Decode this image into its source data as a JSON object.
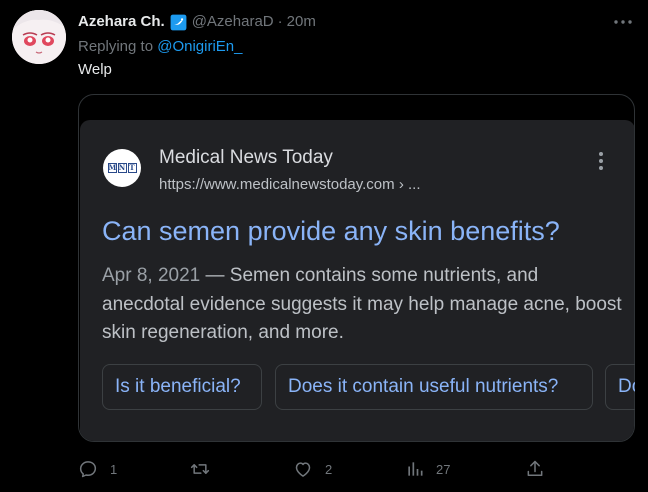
{
  "tweet": {
    "display_name": "Azehara Ch.",
    "handle": "@AzeharaD",
    "separator": "·",
    "time": "20m",
    "reply_prefix": "Replying to",
    "reply_to": "@OnigiriEn_",
    "text": "Welp"
  },
  "search_result": {
    "site_name": "Medical News Today",
    "site_url": "https://www.medicalnewstoday.com › ...",
    "logo_letters": [
      "M",
      "N",
      "T"
    ],
    "title": "Can semen provide any skin benefits?",
    "date": "Apr 8, 2021",
    "snippet": " — Semen contains some nutrients, and anecdotal evidence suggests it may help manage acne, boost skin regeneration, and more.",
    "chips": [
      "Is it beneficial?",
      "Does it contain useful nutrients?",
      "Do"
    ]
  },
  "actions": {
    "reply_count": "1",
    "retweet_count": "",
    "like_count": "2",
    "views_count": "27"
  },
  "colors": {
    "background": "#000000",
    "link_blue": "#1d9bf0",
    "google_link": "#8ab4f8",
    "verified_blue": "#1d9bf0",
    "muted": "#71767b"
  }
}
